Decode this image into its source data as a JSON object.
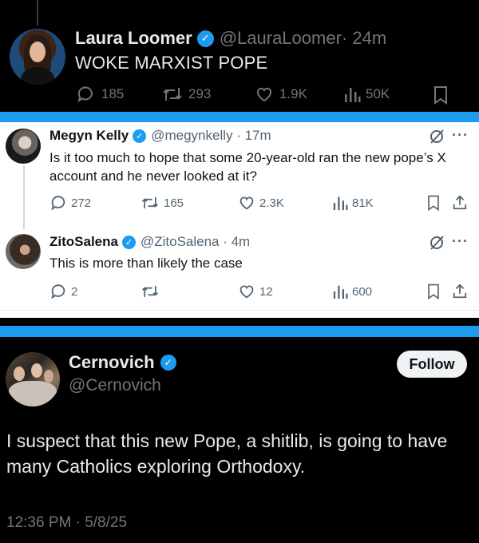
{
  "post1": {
    "name": "Laura Loomer",
    "handle": "@LauraLoomer",
    "time": "· 24m",
    "text": "WOKE MARXIST POPE",
    "replies": "185",
    "reposts": "293",
    "likes": "1.9K",
    "views": "50K"
  },
  "reply1": {
    "name": "Megyn Kelly",
    "handle": "@megynkelly · 17m",
    "text": "Is it too much to hope that some 20-year-old ran the new pope’s X account and he never looked at it?",
    "replies": "272",
    "reposts": "165",
    "likes": "2.3K",
    "views": "81K"
  },
  "reply2": {
    "name": "ZitoSalena",
    "handle": "@ZitoSalena · 4m",
    "text": "This is more than likely the case",
    "replies": "2",
    "likes": "12",
    "views": "600"
  },
  "post3": {
    "name": "Cernovich",
    "handle": "@Cernovich",
    "follow_label": "Follow",
    "text": "I suspect that this new Pope, a shitlib, is going to have many Catholics exploring Orthodoxy.",
    "timestamp": "12:36 PM · 5/8/25"
  },
  "icons": {
    "reply": "reply-icon",
    "repost": "repost-icon",
    "like": "heart-icon",
    "views": "views-icon",
    "bookmark": "bookmark-icon",
    "share": "share-icon",
    "grok": "grok-icon",
    "more": "more-icon",
    "verified": "verified-badge-icon"
  },
  "colors": {
    "accent": "#1d9bf0",
    "dark_bg": "#000000",
    "light_bg": "#ffffff",
    "muted_dark": "#71767b",
    "muted_light": "#536471"
  }
}
